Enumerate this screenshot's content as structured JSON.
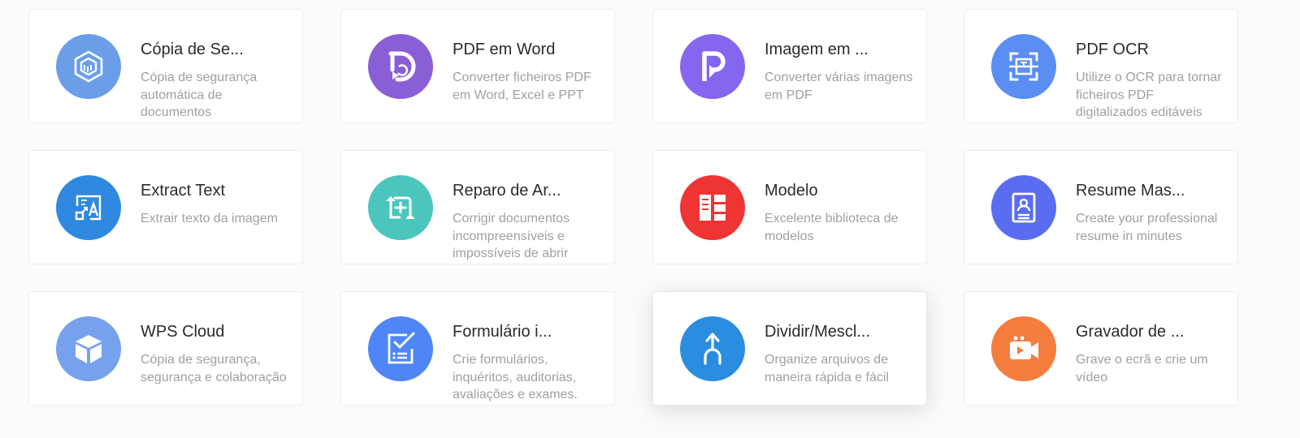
{
  "tools": [
    {
      "title": "Cópia de Se...",
      "desc": "Cópia de segurança automática de documentos",
      "icon": "backup-cube-icon",
      "color": "#6b9ee8"
    },
    {
      "title": "PDF em Word",
      "desc": "Converter ficheiros PDF em Word, Excel e PPT",
      "icon": "pdf-to-word-icon",
      "color": "#8a5fd6"
    },
    {
      "title": "Imagem em ...",
      "desc": "Converter várias imagens em PDF",
      "icon": "image-to-pdf-icon",
      "color": "#8566ee"
    },
    {
      "title": "PDF OCR",
      "desc": "Utilize o OCR para tornar ficheiros PDF digitalizados editáveis",
      "icon": "ocr-scan-icon",
      "color": "#5b8ef2"
    },
    {
      "title": "Extract Text",
      "desc": "Extrair texto da imagem",
      "icon": "extract-text-icon",
      "color": "#2f88e0"
    },
    {
      "title": "Reparo de Ar...",
      "desc": "Corrigir documentos incompreensíveis e impossíveis de abrir",
      "icon": "file-repair-icon",
      "color": "#4cc6bd"
    },
    {
      "title": "Modelo",
      "desc": "Excelente biblioteca de modelos",
      "icon": "template-icon",
      "color": "#ef3434"
    },
    {
      "title": "Resume Mas...",
      "desc": "Create your professional resume in minutes",
      "icon": "resume-icon",
      "color": "#5a6df0"
    },
    {
      "title": "WPS Cloud",
      "desc": "Cópia de segurança, segurança e colaboração",
      "icon": "cloud-box-icon",
      "color": "#76a1ec"
    },
    {
      "title": "Formulário i...",
      "desc": "Crie formulários, inquéritos, auditorias, avaliações e exames.",
      "icon": "form-checklist-icon",
      "color": "#4f86f7"
    },
    {
      "title": "Dividir/Mescl...",
      "desc": "Organize arquivos de maneira rápida e fácil",
      "icon": "split-merge-icon",
      "color": "#2b8de0"
    },
    {
      "title": "Gravador de ...",
      "desc": "Grave o ecrã e crie um vídeo",
      "icon": "screen-recorder-icon",
      "color": "#f57d3e"
    }
  ]
}
